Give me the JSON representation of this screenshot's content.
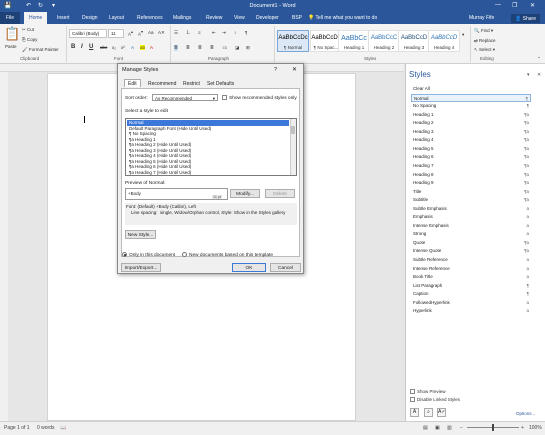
{
  "titlebar": {
    "title": "Document1 - Word",
    "min": "—",
    "restore": "❐",
    "close": "✕"
  },
  "tabs": {
    "file": "File",
    "items": [
      "Home",
      "Insert",
      "Design",
      "Layout",
      "References",
      "Mailings",
      "Review",
      "View",
      "Developer",
      "BSP"
    ],
    "tellme": "Tell me what you want to do",
    "user": "Murray Fife",
    "share": "Share"
  },
  "ribbon": {
    "clipboard": {
      "paste": "Paste",
      "cut": "Cut",
      "copy": "Copy",
      "format_painter": "Format Painter",
      "label": "Clipboard"
    },
    "font": {
      "name": "Calibri (Body)",
      "size": "11",
      "label": "Font"
    },
    "paragraph": {
      "label": "Paragraph"
    },
    "styles": {
      "label": "Styles",
      "items": [
        {
          "preview": "AaBbCcDc",
          "name": "¶ Normal"
        },
        {
          "preview": "AaBbCcDc",
          "name": "¶ No Spac..."
        },
        {
          "preview": "AaBbCc",
          "name": "Heading 1"
        },
        {
          "preview": "AaBbCcC",
          "name": "Heading 2"
        },
        {
          "preview": "AaBbCcD",
          "name": "Heading 3"
        },
        {
          "preview": "AaBbCcD",
          "name": "Heading 4"
        }
      ]
    },
    "editing": {
      "find": "Find",
      "replace": "Replace",
      "select": "Select",
      "label": "Editing"
    }
  },
  "styles_pane": {
    "title": "Styles",
    "items": [
      {
        "name": "Clear All",
        "mark": ""
      },
      {
        "name": "Normal",
        "mark": "¶"
      },
      {
        "name": "No Spacing",
        "mark": "¶"
      },
      {
        "name": "Heading 1",
        "mark": "¶a"
      },
      {
        "name": "Heading 2",
        "mark": "¶a"
      },
      {
        "name": "Heading 3",
        "mark": "¶a"
      },
      {
        "name": "Heading 4",
        "mark": "¶a"
      },
      {
        "name": "Heading 5",
        "mark": "¶a"
      },
      {
        "name": "Heading 6",
        "mark": "¶a"
      },
      {
        "name": "Heading 7",
        "mark": "¶a"
      },
      {
        "name": "Heading 8",
        "mark": "¶a"
      },
      {
        "name": "Heading 9",
        "mark": "¶a"
      },
      {
        "name": "Title",
        "mark": "¶a"
      },
      {
        "name": "Subtitle",
        "mark": "¶a"
      },
      {
        "name": "Subtle Emphasis",
        "mark": "a"
      },
      {
        "name": "Emphasis",
        "mark": "a"
      },
      {
        "name": "Intense Emphasis",
        "mark": "a"
      },
      {
        "name": "Strong",
        "mark": "a"
      },
      {
        "name": "Quote",
        "mark": "¶a"
      },
      {
        "name": "Intense Quote",
        "mark": "¶a"
      },
      {
        "name": "Subtle Reference",
        "mark": "a"
      },
      {
        "name": "Intense Reference",
        "mark": "a"
      },
      {
        "name": "Book Title",
        "mark": "a"
      },
      {
        "name": "List Paragraph",
        "mark": "¶"
      },
      {
        "name": "Caption",
        "mark": "¶"
      },
      {
        "name": "FollowedHyperlink",
        "mark": "a"
      },
      {
        "name": "Hyperlink",
        "mark": "a"
      }
    ],
    "show_preview": "Show Preview",
    "disable_linked": "Disable Linked Styles",
    "options": "Options..."
  },
  "status": {
    "page": "Page 1 of 1",
    "words": "0 words",
    "zoom": "100%"
  },
  "dialog": {
    "title": "Manage Styles",
    "help": "?",
    "close": "✕",
    "tabs": [
      "Edit",
      "Recommend",
      "Restrict",
      "Set Defaults"
    ],
    "sort_label": "Sort order:",
    "sort_value": "As Recommended",
    "show_recommended": "Show recommended styles only",
    "select_label": "Select a style to edit",
    "list": [
      "Normal",
      "Default Paragraph Font  (Hide Until Used)",
      "¶  No Spacing",
      "¶a Heading 1",
      "¶a Heading 2  (Hide Until Used)",
      "¶a Heading 3  (Hide Until Used)",
      "¶a Heading 4  (Hide Until Used)",
      "¶a Heading 5  (Hide Until Used)",
      "¶a Heading 6  (Hide Until Used)",
      "¶a Heading 7  (Hide Until Used)"
    ],
    "preview_label": "Preview of Normal:",
    "preview_text": "+Body",
    "preview_meta": "11 pt",
    "modify": "Modify...",
    "delete": "Delete",
    "description": "Font: (Default) +Body (Calibri), Left\n    Line spacing:  single, Widow/Orphan control, Style: Show in the Styles gallery",
    "new_style": "New Style...",
    "only_doc": "Only in this document",
    "new_docs": "New documents based on this template",
    "import_export": "Import/Export...",
    "ok": "OK",
    "cancel": "Cancel"
  }
}
